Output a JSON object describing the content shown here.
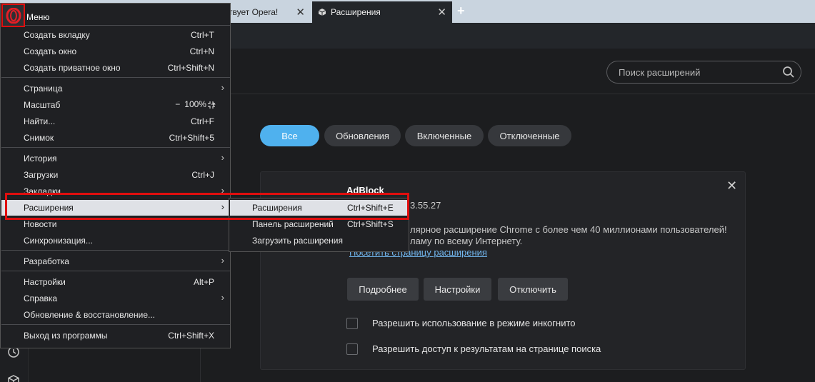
{
  "colors": {
    "accent": "#4fb1ee",
    "highlight_box": "#e00e0e",
    "menu_bg": "#1f2023",
    "menu_highlight": "#dfe1e6",
    "link": "#72b7ef"
  },
  "tabs": [
    {
      "label": "ствует Opera!",
      "icon": "close-icon"
    },
    {
      "label": "Расширения",
      "icon": "cube-icon",
      "active": true
    }
  ],
  "new_tab_label": "+",
  "search": {
    "placeholder": "Поиск расширений",
    "icon": "search-icon"
  },
  "filters": [
    "Все",
    "Обновления",
    "Включенные",
    "Отключенные"
  ],
  "extension": {
    "name": "AdBlock",
    "version": "3.55.27",
    "description_line1": "лярное расширение Chrome с более чем 40 миллионами пользователей!",
    "description_line2": "ламу по всему Интернету.",
    "page_link": "Посетить страницу расширения",
    "buttons": [
      "Подробнее",
      "Настройки",
      "Отключить"
    ],
    "options": [
      "Разрешить использование в режиме инкогнито",
      "Разрешить доступ к результатам на странице поиска"
    ]
  },
  "menu": {
    "title": "Меню",
    "items": [
      {
        "label": "Создать вкладку",
        "shortcut": "Ctrl+T"
      },
      {
        "label": "Создать окно",
        "shortcut": "Ctrl+N"
      },
      {
        "label": "Создать приватное окно",
        "shortcut": "Ctrl+Shift+N"
      },
      {
        "label": "Страница",
        "shortcut": ""
      },
      {
        "label": "Масштаб",
        "shortcut": ""
      },
      {
        "label": "Найти...",
        "shortcut": "Ctrl+F"
      },
      {
        "label": "Снимок",
        "shortcut": "Ctrl+Shift+5"
      },
      {
        "label": "История",
        "shortcut": ""
      },
      {
        "label": "Загрузки",
        "shortcut": "Ctrl+J"
      },
      {
        "label": "Закладки",
        "shortcut": ""
      },
      {
        "label": "Расширения",
        "shortcut": ""
      },
      {
        "label": "Новости",
        "shortcut": ""
      },
      {
        "label": "Синхронизация...",
        "shortcut": ""
      },
      {
        "label": "Разработка",
        "shortcut": ""
      },
      {
        "label": "Настройки",
        "shortcut": "Alt+P"
      },
      {
        "label": "Справка",
        "shortcut": ""
      },
      {
        "label": "Обновление & восстановление...",
        "shortcut": ""
      },
      {
        "label": "Выход из программы",
        "shortcut": "Ctrl+Shift+X"
      }
    ],
    "zoom": {
      "minus": "−",
      "value": "100%",
      "plus": "+"
    }
  },
  "submenu": {
    "items": [
      {
        "label": "Расширения",
        "shortcut": "Ctrl+Shift+E"
      },
      {
        "label": "Панель расширений",
        "shortcut": "Ctrl+Shift+S"
      },
      {
        "label": "Загрузить расширения",
        "shortcut": ""
      }
    ]
  }
}
